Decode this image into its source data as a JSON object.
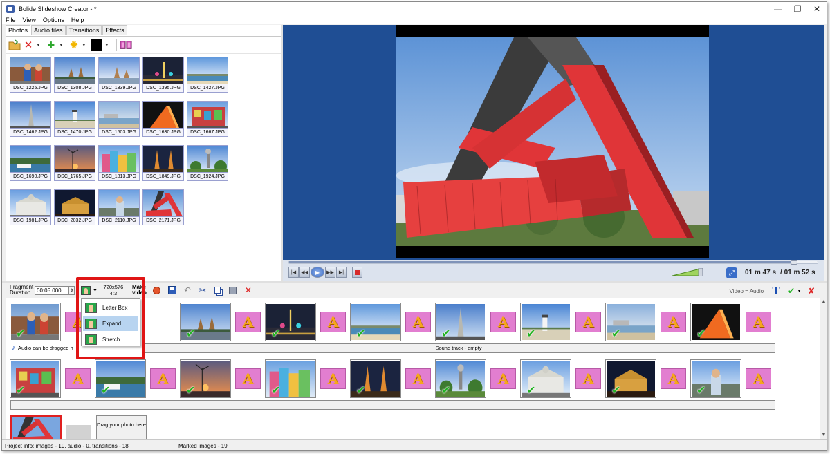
{
  "window": {
    "title": "Bolide Slideshow Creator - *",
    "controls": [
      "—",
      "❐",
      "✕"
    ]
  },
  "menu": [
    "File",
    "View",
    "Options",
    "Help"
  ],
  "tabs": [
    "Photos",
    "Audio files",
    "Transitions",
    "Effects"
  ],
  "active_tab": "Photos",
  "photos": [
    {
      "name": "DSC_1225.JPG",
      "scene": "statue"
    },
    {
      "name": "DSC_1308.JPG",
      "scene": "temple"
    },
    {
      "name": "DSC_1339.JPG",
      "scene": "temple2"
    },
    {
      "name": "DSC_1395.JPG",
      "scene": "night-lights"
    },
    {
      "name": "DSC_1427.JPG",
      "scene": "coast"
    },
    {
      "name": "DSC_1462.JPG",
      "scene": "pagoda"
    },
    {
      "name": "DSC_1470.JPG",
      "scene": "lighthouse"
    },
    {
      "name": "DSC_1503.JPG",
      "scene": "beach"
    },
    {
      "name": "DSC_1630.JPG",
      "scene": "orange-sculpture"
    },
    {
      "name": "DSC_1667.JPG",
      "scene": "mural"
    },
    {
      "name": "DSC_1690.JPG",
      "scene": "harbor"
    },
    {
      "name": "DSC_1765.JPG",
      "scene": "sunset-windmill"
    },
    {
      "name": "DSC_1813.JPG",
      "scene": "colorful-buildings"
    },
    {
      "name": "DSC_1849.JPG",
      "scene": "pagodas-night"
    },
    {
      "name": "DSC_1924.JPG",
      "scene": "park-tower"
    },
    {
      "name": "DSC_1981.JPG",
      "scene": "museum"
    },
    {
      "name": "DSC_2032.JPG",
      "scene": "palace-night"
    },
    {
      "name": "DSC_2110.JPG",
      "scene": "statue2"
    },
    {
      "name": "DSC_2171.JPG",
      "scene": "red-containers"
    }
  ],
  "player": {
    "position": 0.955,
    "time_current": "01 m 47 s",
    "time_total": "/ 01 m 52 s"
  },
  "storyboard": {
    "fragment_label": "Fragment Duration",
    "fragment_value": "00:05.000",
    "resolution": "720x576",
    "aspect": "4:3",
    "make_video": "Make video",
    "video_audio": "Video = Audio"
  },
  "dropdown": {
    "items": [
      "Letter Box",
      "Expand",
      "Stretch"
    ],
    "active": "Expand"
  },
  "timeline": {
    "row1": [
      "statue",
      "temple",
      "night-lights",
      "coast",
      "pagoda",
      "lighthouse",
      "beach",
      "orange-sculpture"
    ],
    "row2": [
      "mural",
      "harbor",
      "sunset-windmill",
      "colorful-buildings",
      "pagodas-night",
      "park-tower",
      "museum",
      "palace-night",
      "statue2"
    ],
    "audio_hint": "Audio can be dragged h",
    "soundtrack": "Sound track - empty",
    "drag_hint": "Drag your photo here"
  },
  "status": {
    "project": "Project info: images - 19, audio - 0, transitions - 18",
    "marked": "Marked images - 19"
  },
  "colors": {
    "preview_bg": "#1f4e94",
    "highlight": "#e01515",
    "check": "#21b321",
    "transition": "#e27ed0"
  }
}
